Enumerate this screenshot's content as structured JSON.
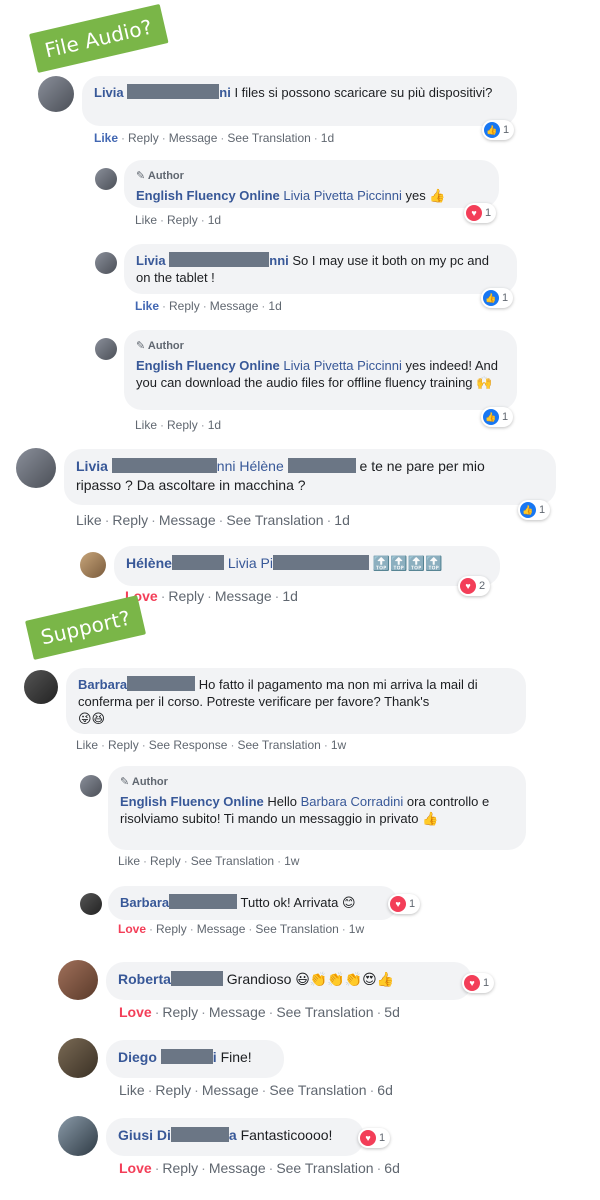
{
  "tags": {
    "file_audio": "File Audio?",
    "support": "Support?"
  },
  "colors": {
    "tag_green": "#7ab648",
    "link_blue": "#385898",
    "like_blue": "#4267b2",
    "love_red": "#f33e58",
    "bubble_gray": "#f2f3f5"
  },
  "c1": {
    "name": "Livia",
    "name_tail": "ni",
    "text": "I files si possono scaricare su più dispositivi?",
    "actions": [
      "Like",
      "Reply",
      "Message",
      "See Translation",
      "1d"
    ],
    "reaction_count": "1"
  },
  "c2": {
    "author_label": "Author",
    "name": "English Fluency Online",
    "mention": "Livia Pivetta Piccinni",
    "text": "yes",
    "emoji": "👍",
    "actions": [
      "Like",
      "Reply",
      "1d"
    ],
    "reaction_count": "1"
  },
  "c3": {
    "name": "Livia",
    "name_tail": "nni",
    "text": "So I may use it both on my pc and on the tablet !",
    "actions": [
      "Like",
      "Reply",
      "Message",
      "1d"
    ],
    "reaction_count": "1"
  },
  "c4": {
    "author_label": "Author",
    "name": "English Fluency Online",
    "mention": "Livia Pivetta Piccinni",
    "text": "yes indeed! And you can download the audio files for offline fluency training",
    "emoji": "🙌",
    "actions": [
      "Like",
      "Reply",
      "1d"
    ],
    "reaction_count": "1"
  },
  "c5": {
    "name": "Livia",
    "mention_tail": "nni",
    "mention2": "Hélène",
    "text_a": "e te ne pare per mio",
    "text_b": "ripasso ? Da ascoltare in macchina ?",
    "actions": [
      "Like",
      "Reply",
      "Message",
      "See Translation",
      "1d"
    ],
    "reaction_count": "1"
  },
  "c6": {
    "name": "Hélène",
    "mention": "Livia Pi",
    "emoji": "🔝🔝🔝🔝",
    "actions": [
      "Love",
      "Reply",
      "Message",
      "1d"
    ],
    "reaction_count": "2"
  },
  "c7": {
    "name": "Barbara",
    "text_a": "Ho fatto il pagamento ma non mi arriva la mail di conferma per il corso. Potreste verificare per favore? Thank's",
    "emoji": "😜😆",
    "actions": [
      "Like",
      "Reply",
      "See Response",
      "See Translation",
      "1w"
    ]
  },
  "c8": {
    "author_label": "Author",
    "name": "English Fluency Online",
    "text_a": "Hello",
    "mention": "Barbara Corradini",
    "text_b": "ora controllo e risolviamo subito! Ti mando un messaggio in privato",
    "emoji": "👍",
    "actions": [
      "Like",
      "Reply",
      "See Translation",
      "1w"
    ]
  },
  "c9": {
    "name": "Barbara",
    "text": "Tutto ok! Arrivata",
    "emoji": "😊",
    "actions": [
      "Love",
      "Reply",
      "Message",
      "See Translation",
      "1w"
    ],
    "reaction_count": "1"
  },
  "c10": {
    "name": "Roberta",
    "text": "Grandioso",
    "emoji": "😃👏👏👏😍👍",
    "actions": [
      "Love",
      "Reply",
      "Message",
      "See Translation",
      "5d"
    ],
    "reaction_count": "1"
  },
  "c11": {
    "name": "Diego",
    "name_tail": "i",
    "text": "Fine!",
    "actions": [
      "Like",
      "Reply",
      "Message",
      "See Translation",
      "6d"
    ]
  },
  "c12": {
    "name": "Giusi Di",
    "name_tail": "a",
    "text": "Fantasticoooo!",
    "actions": [
      "Love",
      "Reply",
      "Message",
      "See Translation",
      "6d"
    ],
    "reaction_count": "1"
  }
}
